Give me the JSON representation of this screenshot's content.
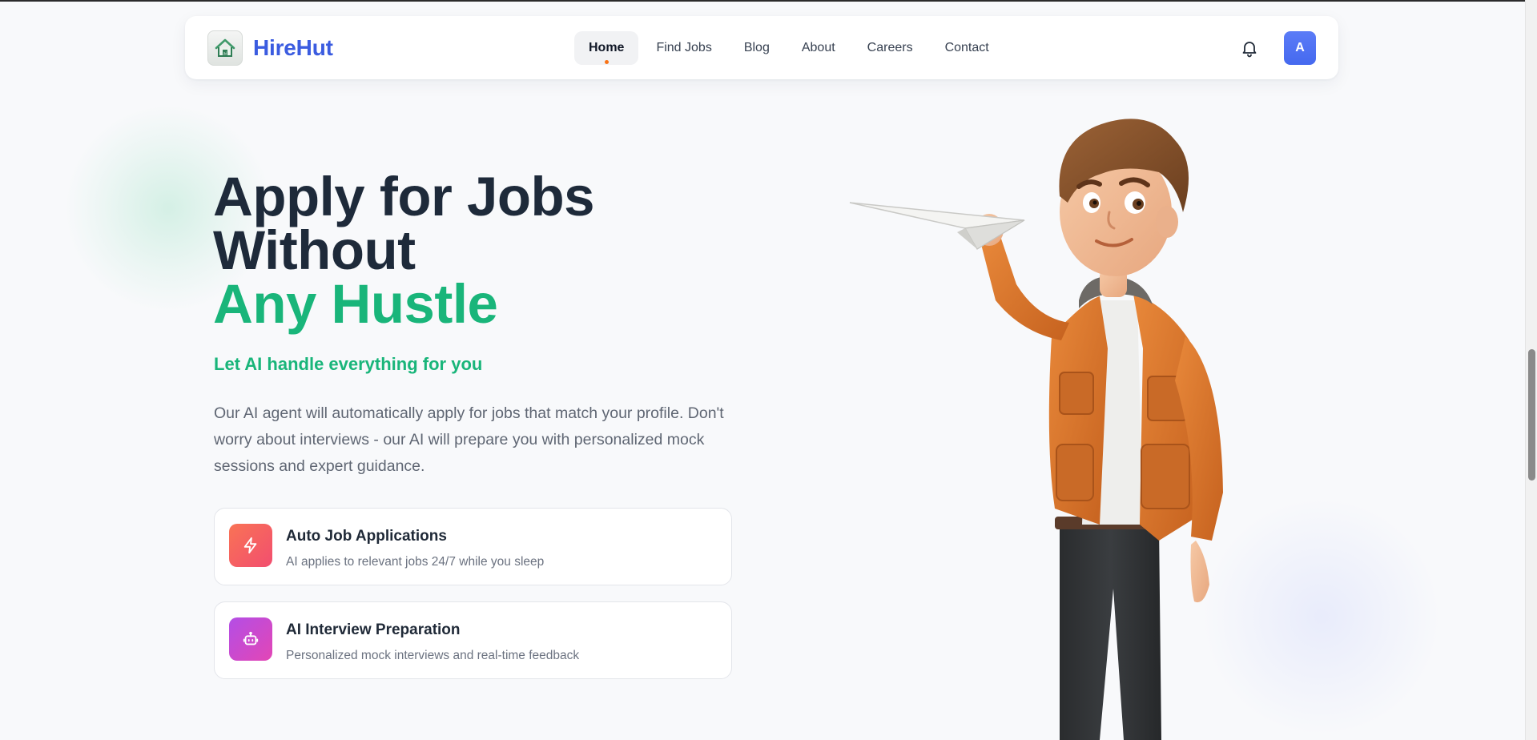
{
  "brand": {
    "name": "HireHut",
    "logo_icon": "house-logo-icon"
  },
  "nav": {
    "items": [
      {
        "label": "Home",
        "active": true
      },
      {
        "label": "Find Jobs",
        "active": false
      },
      {
        "label": "Blog",
        "active": false
      },
      {
        "label": "About",
        "active": false
      },
      {
        "label": "Careers",
        "active": false
      },
      {
        "label": "Contact",
        "active": false
      }
    ],
    "notification_icon": "bell-icon",
    "avatar_initial": "A"
  },
  "hero": {
    "title_line1": "Apply for Jobs",
    "title_line2": "Without",
    "title_line3": "Any Hustle",
    "tagline": "Let AI handle everything for you",
    "description": "Our AI agent will automatically apply for jobs that match your profile. Don't worry about interviews - our AI will prepare you with personalized mock sessions and expert guidance.",
    "illustration": "boy-throwing-paper-plane-illustration"
  },
  "features": [
    {
      "title": "Auto Job Applications",
      "description": "AI applies to relevant jobs 24/7 while you sleep",
      "icon": "lightning-icon",
      "color": "#f9604f"
    },
    {
      "title": "AI Interview Preparation",
      "description": "Personalized mock interviews and real-time feedback",
      "icon": "robot-icon",
      "color": "#c94bd6"
    }
  ],
  "colors": {
    "brand": "#3b5ce0",
    "accent_green": "#19b57a",
    "active_dot": "#f97316",
    "heading": "#1e2a3a"
  }
}
